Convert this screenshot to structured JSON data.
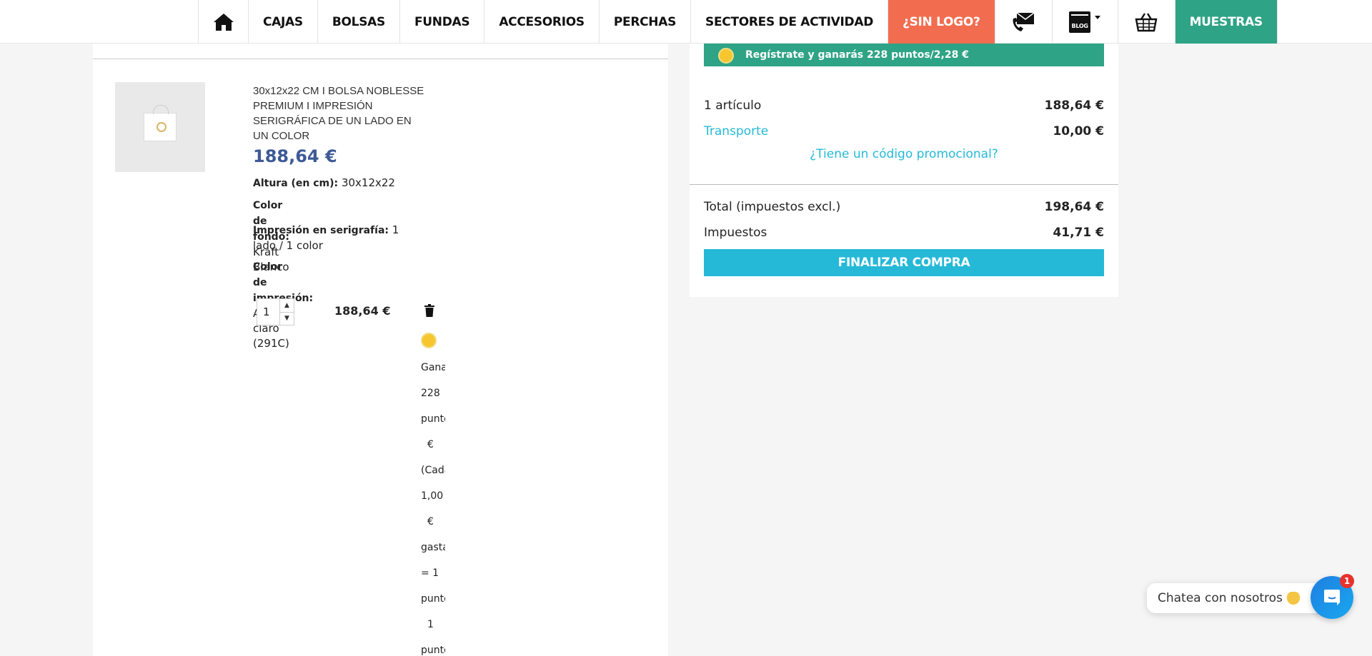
{
  "nav": {
    "items": [
      "CAJAS",
      "BOLSAS",
      "FUNDAS",
      "ACCESORIOS",
      "PERCHAS",
      "SECTORES DE ACTIVIDAD"
    ],
    "sin_logo": "¿SIN LOGO?",
    "blog": "BLOG",
    "muestras": "MUESTRAS",
    "accent_orange": "#f26d50",
    "accent_green": "#2fa386"
  },
  "product": {
    "title": "30x12x22 CM I BOLSA NOBLESSE PREMIUM I IMPRESIÓN SERIGRÁFICA DE UN LADO EN UN COLOR",
    "price": "188,64 €",
    "altura_label": "Altura (en cm)",
    "altura_value": "30x12x22",
    "color_fondo_label": "Color de fondo:",
    "color_fondo_value": "Kraft Blanco",
    "impresion_label": "Impresión en serigrafía:",
    "impresion_value": "1 lado / 1 color",
    "color_impresion_label": "Color de impresión:",
    "color_impresion_value": "Azul claro (291C)",
    "quantity": "1",
    "line_total": "188,64 €",
    "points_text": [
      "Gana",
      "228",
      "punto",
      "€",
      "(Cada",
      "1,00",
      "€",
      "gasta",
      "= 1",
      "punto",
      "1",
      "punto"
    ]
  },
  "summary": {
    "register_text": "Regístrate y ganarás 228 puntos/2,28 €",
    "articles_label": "1 artículo",
    "articles_value": "188,64 €",
    "shipping_label": "Transporte",
    "shipping_value": "10,00 €",
    "promo_link": "¿Tiene un código promocional?",
    "total_label": "Total (impuestos excl.)",
    "total_value": "198,64 €",
    "tax_label": "Impuestos",
    "tax_value": "41,71 €",
    "checkout_label": "FINALIZAR COMPRA",
    "accent_blue": "#25b9d7"
  },
  "chat": {
    "bubble_text": "Chatea con nosotros",
    "badge": "1"
  }
}
